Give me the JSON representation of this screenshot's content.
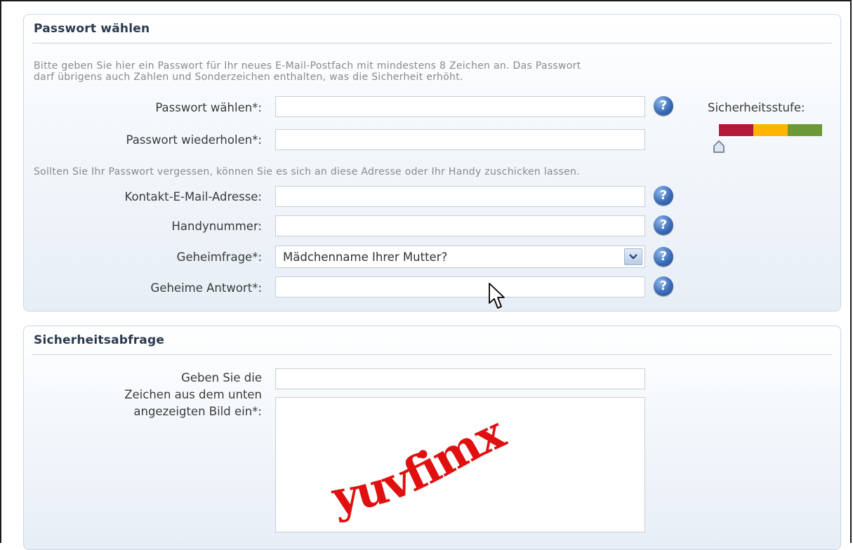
{
  "password_section": {
    "title": "Passwort wählen",
    "intro_line1": "Bitte geben Sie hier ein Passwort für Ihr neues E-Mail-Postfach mit mindestens 8 Zeichen an. Das Passwort",
    "intro_line2": "darf übrigens auch Zahlen und Sonderzeichen enthalten, was die Sicherheit erhöht.",
    "password_label": "Passwort wählen*:",
    "password_value": "",
    "repeat_label": "Passwort wiederholen*:",
    "repeat_value": "",
    "strength_label": "Sicherheitsstufe:",
    "strength_level": 0,
    "strength_colors": [
      "#b3173a",
      "#ffb400",
      "#6e9a35"
    ],
    "recovery_hint": "Sollten Sie Ihr Passwort vergessen, können Sie es sich an diese Adresse oder Ihr Handy zuschicken lassen.",
    "contact_email_label": "Kontakt-E-Mail-Adresse:",
    "contact_email_value": "",
    "mobile_label": "Handynummer:",
    "mobile_value": "",
    "question_label": "Geheimfrage*:",
    "question_selected": "Mädchenname Ihrer Mutter?",
    "answer_label": "Geheime Antwort*:",
    "answer_value": "",
    "help_icon_glyph": "?"
  },
  "captcha_section": {
    "title": "Sicherheitsabfrage",
    "label_line1": "Geben Sie die",
    "label_line2": "Zeichen aus dem unten",
    "label_line3": "angezeigten Bild ein*:",
    "captcha_value": "",
    "captcha_text": "yuvfimx",
    "captcha_color": "#e01010"
  }
}
